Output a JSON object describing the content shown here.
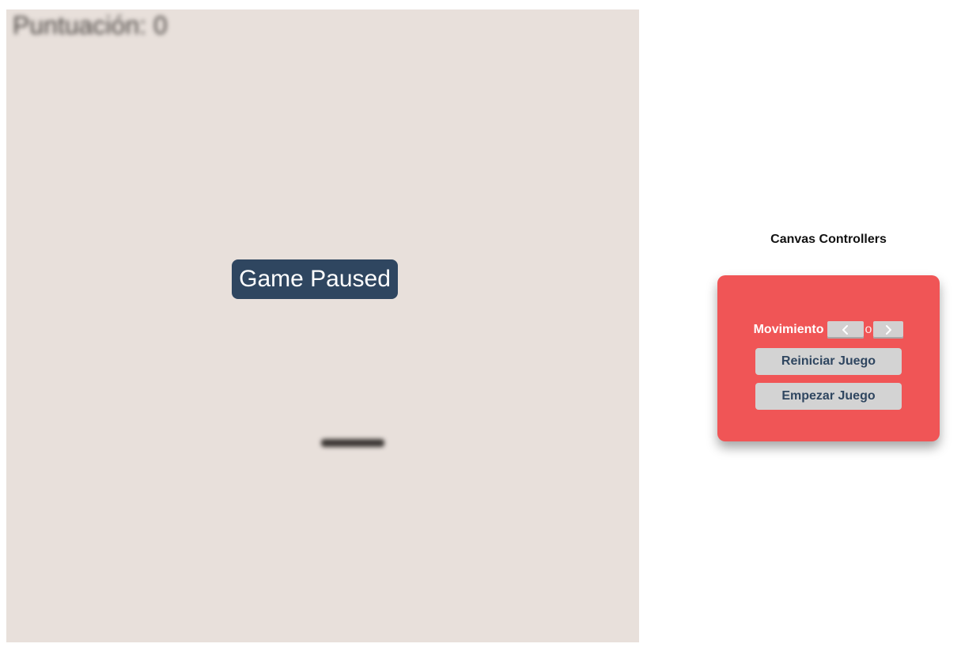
{
  "game": {
    "score_text": "Puntuación: 0",
    "paused_text": "Game Paused"
  },
  "controls": {
    "title": "Canvas Controllers",
    "movement_label": "Movimiento",
    "movement_separator": "o",
    "left_key_icon": "chevron-left-icon",
    "right_key_icon": "chevron-right-icon",
    "restart_label": "Reiniciar Juego",
    "start_label": "Empezar Juego"
  },
  "colors": {
    "canvas_bg": "#e8e0db",
    "overlay_bg": "#2f4660",
    "panel_bg": "#f05556",
    "button_bg": "#d3d3d3",
    "button_text": "#2f4660",
    "paddle": "#3a3633"
  }
}
